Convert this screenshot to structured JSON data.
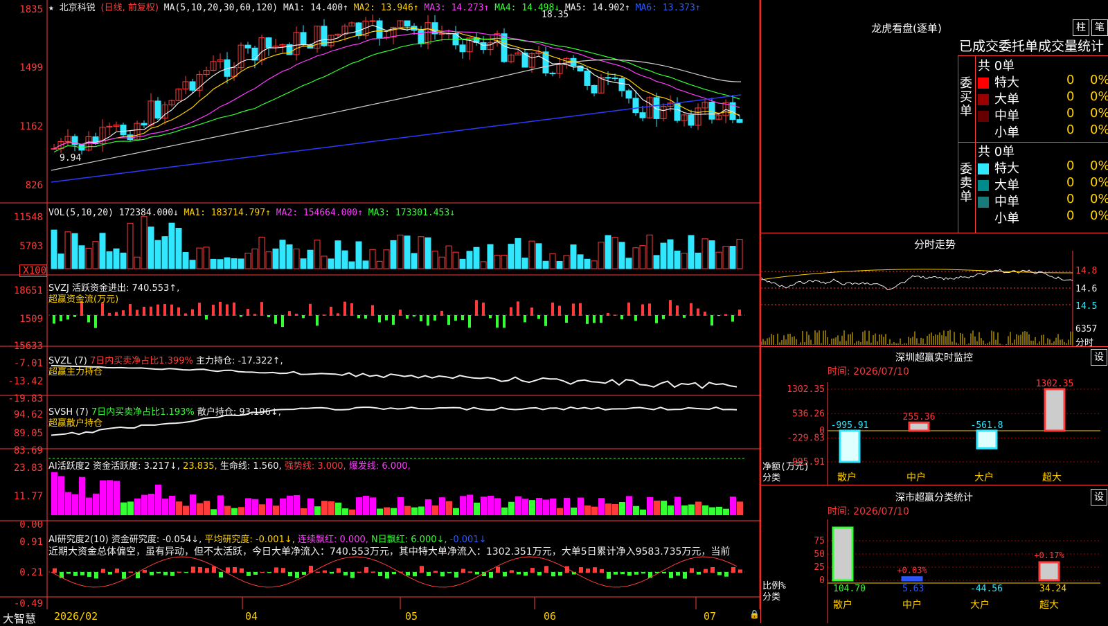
{
  "header": {
    "star": "★",
    "stock_name": "北京科锐",
    "mode": "(日线, 前复权)",
    "ma_params": "MA(5,10,20,30,60,120)",
    "ma1": "MA1: 14.400↑",
    "ma2": "MA2: 13.946↑",
    "ma3": "MA3: 14.273↑",
    "ma4": "MA4: 14.498↓",
    "ma5": "MA5: 14.902↑",
    "ma6": "MA6: 13.373↑"
  },
  "price_axis": [
    "1835",
    "1499",
    "1162",
    "826"
  ],
  "price_annotations": {
    "high": "18.35",
    "low": "9.94"
  },
  "vol": {
    "axis": [
      "11548",
      "5703",
      "X100"
    ],
    "title": "VOL(5,10,20)",
    "v": "172384.000↓",
    "ma1": "MA1: 183714.797↑",
    "ma2": "MA2: 154664.000↑",
    "ma3": "MA3: 173301.453↓"
  },
  "svzj": {
    "axis": [
      "18651",
      "1509",
      "-15633"
    ],
    "line1": "SVZJ  活跃资金进出: 740.553↑,",
    "line2": "超赢资金流(万元)"
  },
  "svzl": {
    "axis": [
      "-7.01",
      "-13.42",
      "-19.83"
    ],
    "title": "SVZL (7)",
    "desc": "7日内买卖净占比1.399%",
    "value": "主力持仓: -17.322↑,",
    "line2": "超赢主力持仓"
  },
  "svsh": {
    "axis": [
      "94.62",
      "89.05",
      "83.69"
    ],
    "title": "SVSH (7)",
    "desc": "7日内买卖净占比1.193%",
    "value": "散户持仓: 93.196↓,",
    "line2": "超赢散户持仓"
  },
  "ai1": {
    "axis": [
      "23.83",
      "11.77",
      "0.00"
    ],
    "title": "AI活跃度2",
    "v1": "资金活跃度: 3.217↓,",
    "v2": "23.835,",
    "v3": "生命线: 1.560,",
    "v4": "强势线: 3.000,",
    "v5": "爆发线: 6.000,"
  },
  "ai2": {
    "axis": [
      "0.91",
      "0.21",
      "-0.49"
    ],
    "title": "AI研究度2(10)",
    "v1": "资金研究度: -0.054↓,",
    "v2": "平均研究度: -0.001↓,",
    "v3": "连续飘红: 0.000,",
    "v4": "N日飘红: 6.000↓,",
    "v5": "-0.001↓",
    "summary": "近期大资金总体偏空，虽有异动，但不太活跃，今日大单净流入：740.553万元，其中特大单净流入：1302.351万元，大单5日累计净入9583.735万元，当前"
  },
  "date_axis": [
    "2026/02",
    "04",
    "05",
    "06",
    "07"
  ],
  "footer_logo": "大智慧",
  "lhkp": {
    "title": "龙虎看盘(逐单)",
    "btn1": "柱",
    "btn2": "笔",
    "subtitle": "已成交委托单成交量统计",
    "buy_label": "委买单",
    "sell_label": "委卖单",
    "buy_total": "共 0单",
    "sell_total": "共 0单",
    "rows": [
      {
        "name": "特大",
        "count": "0",
        "pct": "0%"
      },
      {
        "name": "大单",
        "count": "0",
        "pct": "0%"
      },
      {
        "name": "中单",
        "count": "0",
        "pct": "0%"
      },
      {
        "name": "小单",
        "count": "0",
        "pct": "0%"
      }
    ],
    "buy_colors": [
      "#ff0000",
      "#990000",
      "#660000",
      "#000000"
    ],
    "sell_colors": [
      "#31e7ff",
      "#008b8b",
      "#1a7a7a",
      "#000000"
    ]
  },
  "intraday": {
    "title": "分时走势",
    "axis": [
      "14.8",
      "14.6",
      "14.5"
    ],
    "vol_label": "6357",
    "unit": "分时"
  },
  "szmon": {
    "title": "深圳超赢实时监控",
    "btn": "设",
    "date": "时间: 2026/07/10",
    "axis": [
      "1302.35",
      "536.26",
      "0",
      "-229.83",
      "-995.91"
    ],
    "ylabel": "净额(万元)",
    "xlabel": "分类",
    "categories": [
      "散户",
      "中户",
      "大户",
      "超大"
    ],
    "values": [
      -995.91,
      255.36,
      -561.8,
      1302.35
    ],
    "value_labels": [
      "-995.91",
      "255.36",
      "-561.8",
      "1302.35"
    ]
  },
  "szcls": {
    "title": "深市超赢分类统计",
    "btn": "设",
    "date": "时间: 2026/07/10",
    "axis": [
      "75",
      "50",
      "25",
      "0"
    ],
    "ylabel": "比例%",
    "xlabel": "分类",
    "categories": [
      "散户",
      "中户",
      "大户",
      "超大"
    ],
    "values": [
      104.7,
      5.63,
      -44.56,
      34.24
    ],
    "value_labels": [
      "104.70",
      "5.63",
      "-44.56",
      "34.24"
    ],
    "top_labels": [
      "",
      "+0.03%",
      "",
      "+0.17%"
    ]
  }
}
